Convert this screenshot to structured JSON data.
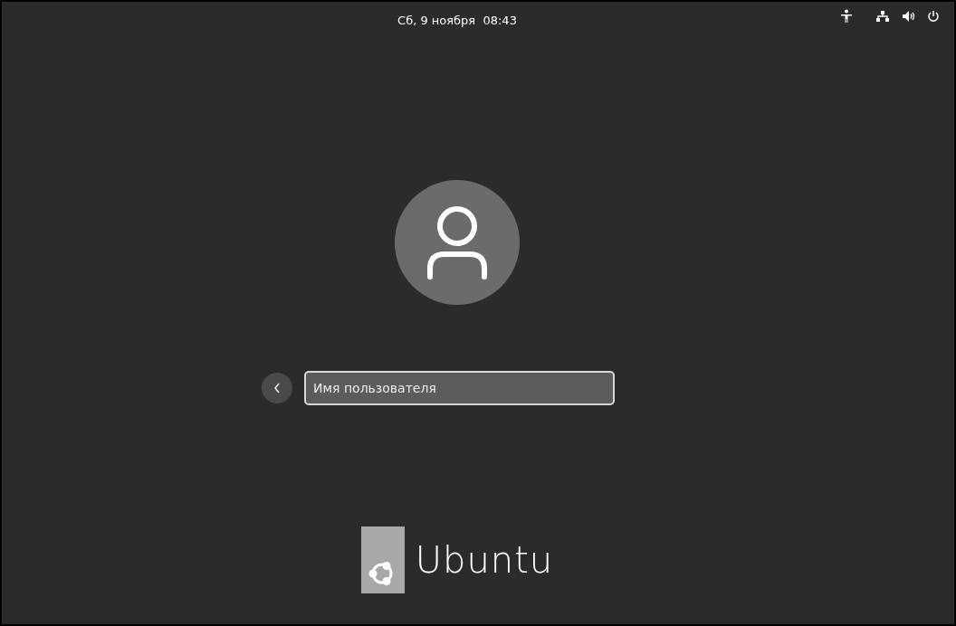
{
  "top_bar": {
    "clock": "Сб, 9 ноября  08:43"
  },
  "login": {
    "username_field": {
      "placeholder": "Имя пользователя"
    }
  },
  "logo": {
    "text": "Ubuntu"
  }
}
